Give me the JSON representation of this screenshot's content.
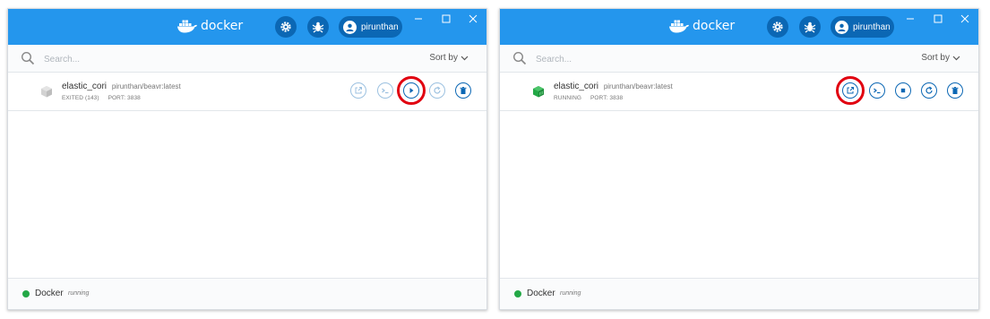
{
  "colors": {
    "brand": "#2496ed",
    "accent": "#0b67b4",
    "running": "#23a846",
    "exited": "#c5c5c5",
    "highlight": "#e10010"
  },
  "windows": [
    {
      "logo_text": "docker",
      "user": "pirunthan",
      "search_placeholder": "Search...",
      "sort_label": "Sort by",
      "container": {
        "name": "elastic_cori",
        "image": "pirunthan/beavr:latest",
        "status": "EXITED (143)",
        "port": "PORT: 3838",
        "state": "exited"
      },
      "actions": [
        {
          "icon": "open-browser-icon",
          "state": "disabled"
        },
        {
          "icon": "cli-icon",
          "state": "disabled"
        },
        {
          "icon": "start-icon",
          "state": "enabled",
          "highlighted": true
        },
        {
          "icon": "restart-icon",
          "state": "disabled"
        },
        {
          "icon": "delete-icon",
          "state": "enabled"
        }
      ],
      "footer": {
        "label": "Docker",
        "status": "running"
      }
    },
    {
      "logo_text": "docker",
      "user": "pirunthan",
      "search_placeholder": "Search...",
      "sort_label": "Sort by",
      "container": {
        "name": "elastic_cori",
        "image": "pirunthan/beavr:latest",
        "status": "RUNNING",
        "port": "PORT: 3838",
        "state": "running"
      },
      "actions": [
        {
          "icon": "open-browser-icon",
          "state": "enabled",
          "highlighted": true
        },
        {
          "icon": "cli-icon",
          "state": "enabled"
        },
        {
          "icon": "stop-icon",
          "state": "enabled"
        },
        {
          "icon": "restart-icon",
          "state": "enabled"
        },
        {
          "icon": "delete-icon",
          "state": "enabled"
        }
      ],
      "footer": {
        "label": "Docker",
        "status": "running"
      }
    }
  ]
}
